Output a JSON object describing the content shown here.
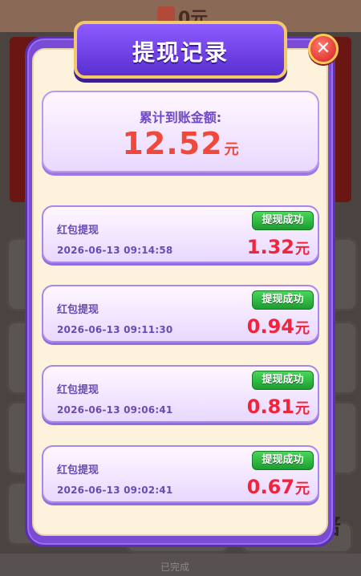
{
  "background": {
    "top_text": "0元",
    "multiplier_text": "倍",
    "bottom_text": "已完成"
  },
  "modal": {
    "title": "提现记录",
    "close_symbol": "✕",
    "total": {
      "label": "累计到账金额:",
      "amount": "12.52",
      "unit": "元"
    },
    "records": [
      {
        "title": "红包提现",
        "time": "2026-06-13 09:14:58",
        "status": "提现成功",
        "amount": "1.32",
        "unit": "元"
      },
      {
        "title": "红包提现",
        "time": "2026-06-13 09:11:30",
        "status": "提现成功",
        "amount": "0.94",
        "unit": "元"
      },
      {
        "title": "红包提现",
        "time": "2026-06-13 09:06:41",
        "status": "提现成功",
        "amount": "0.81",
        "unit": "元"
      },
      {
        "title": "红包提现",
        "time": "2026-06-13 09:02:41",
        "status": "提现成功",
        "amount": "0.67",
        "unit": "元"
      }
    ]
  },
  "colors": {
    "accent_purple": "#7a4bd4",
    "amount_red": "#f0243a",
    "status_green": "#1d9d2f",
    "cream_panel": "#fdf2dc"
  }
}
